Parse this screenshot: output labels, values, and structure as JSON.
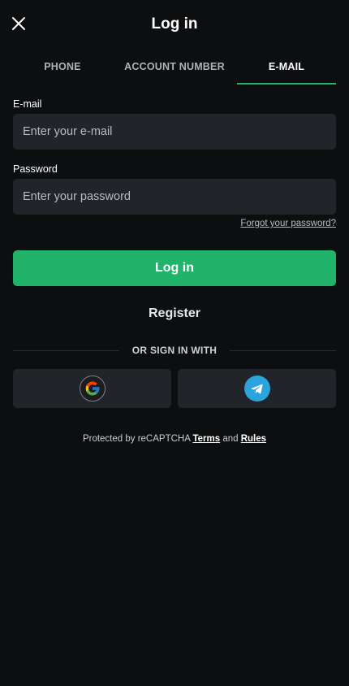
{
  "header": {
    "title": "Log in"
  },
  "tabs": [
    {
      "label": "PHONE"
    },
    {
      "label": "ACCOUNT NUMBER"
    },
    {
      "label": "E-MAIL",
      "active": true
    }
  ],
  "form": {
    "email_label": "E-mail",
    "email_placeholder": "Enter your e-mail",
    "password_label": "Password",
    "password_placeholder": "Enter your password",
    "forgot_label": "Forgot your password?",
    "login_label": "Log in",
    "register_label": "Register"
  },
  "social": {
    "divider_label": "OR SIGN IN WITH",
    "providers": [
      {
        "icon": "google-icon"
      },
      {
        "icon": "telegram-icon"
      }
    ]
  },
  "footer": {
    "prefix": "Protected by reCAPTCHA",
    "terms": "Terms",
    "and": "and",
    "rules": "Rules"
  },
  "colors": {
    "background": "#0c0e10",
    "accent": "#21b36a",
    "input_bg": "#21252a",
    "telegram": "#2aa3df"
  }
}
